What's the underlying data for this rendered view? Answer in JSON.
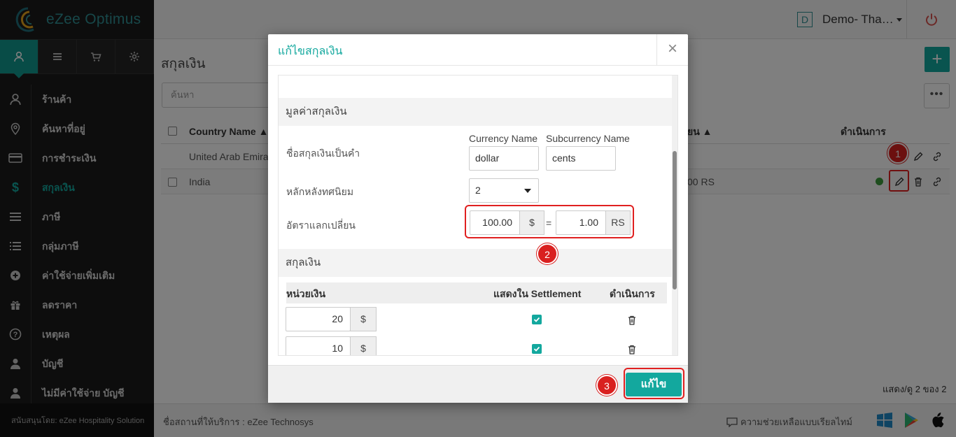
{
  "brand": {
    "name": "eZee Optimus"
  },
  "sidebar": {
    "tabs": [
      {
        "icon": "user-icon"
      },
      {
        "icon": "list-icon"
      },
      {
        "icon": "cart-icon"
      },
      {
        "icon": "gear-icon"
      }
    ],
    "items": [
      {
        "label": "ร้านค้า",
        "icon": "user-icon"
      },
      {
        "label": "ค้นหาที่อยู่",
        "icon": "location-pin-icon"
      },
      {
        "label": "การชำระเงิน",
        "icon": "credit-card-icon"
      },
      {
        "label": "สกุลเงิน",
        "icon": "dollar-icon"
      },
      {
        "label": "ภาษี",
        "icon": "list-lines-icon"
      },
      {
        "label": "กลุ่มภาษี",
        "icon": "list-bullets-icon"
      },
      {
        "label": "ค่าใช้จ่ายเพิ่มเติม",
        "icon": "plus-circle-icon"
      },
      {
        "label": "ลดราคา",
        "icon": "gift-icon"
      },
      {
        "label": "เหตุผล",
        "icon": "question-circle-icon"
      },
      {
        "label": "บัญชี",
        "icon": "user-solid-icon"
      },
      {
        "label": "ไม่มีค่าใช้จ่าย บัญชี",
        "icon": "user-solid-icon"
      }
    ],
    "footer": "สนับสนุนโดย: eZee Hospitality Solution"
  },
  "topbar": {
    "location_badge": "D",
    "location_name": "Demo- Tha…"
  },
  "main": {
    "title": "สกุลเงิน",
    "search_placeholder": "ค้นหา",
    "columns": {
      "country": "Country Name ▲",
      "rate": "ยน ▲",
      "actions": "ดำเนินการ"
    },
    "rows": [
      {
        "country": "United Arab Emira",
        "rate": ""
      },
      {
        "country": "India",
        "rate": "00 RS"
      }
    ],
    "pager": "แสดง/ดู 2 ของ 2"
  },
  "footer": {
    "provider": "ชื่อสถานที่ให้บริการ : eZee Technosys",
    "help": "ความช่วยเหลือแบบเรียลไทม์"
  },
  "modal": {
    "title": "แก้ไขสกุลเงิน",
    "close": "×",
    "value_section": "มูลค่าสกุลเงิน",
    "currency_name_label": "ชื่อสกุลเงินเป็นคำ",
    "currency_name_caption": "Currency Name",
    "subcurrency_name_caption": "Subcurrency Name",
    "currency_name_value": "dollar",
    "subcurrency_name_value": "cents",
    "decimal_label": "หลักหลังทศนิยม",
    "decimal_value": "2",
    "exchange_label": "อัตราแลกเปลี่ยน",
    "rate_from": "100.00",
    "rate_from_symbol": "$",
    "equals": "=",
    "rate_to": "1.00",
    "rate_to_symbol": "RS",
    "currency_section": "สกุลเงิน",
    "grid": {
      "col_unit": "หน่วยเงิน",
      "col_settlement": "แสดงใน Settlement",
      "col_action": "ดำเนินการ",
      "rows": [
        {
          "value": "20",
          "symbol": "$",
          "settlement": true
        },
        {
          "value": "10",
          "symbol": "$",
          "settlement": true
        }
      ]
    },
    "save_label": "แก้ไข"
  },
  "annotations": {
    "step1": "1",
    "step2": "2",
    "step3": "3"
  },
  "colors": {
    "accent": "#13a89e",
    "highlight": "#e02020",
    "sidebar_bg": "#1b1b1b"
  }
}
